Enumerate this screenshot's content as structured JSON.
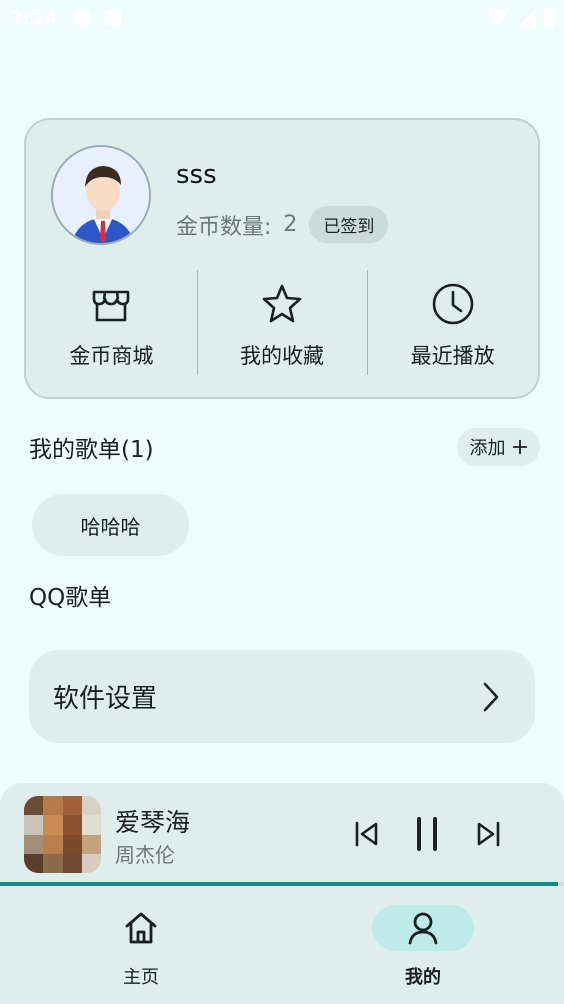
{
  "status_bar": {
    "time": "3:14"
  },
  "profile": {
    "username": "sss",
    "coins_label": "金币数量:",
    "coins_value": "2",
    "checkin_badge": "已签到"
  },
  "actions": [
    {
      "label": "金币商城",
      "icon": "store-icon"
    },
    {
      "label": "我的收藏",
      "icon": "star-icon"
    },
    {
      "label": "最近播放",
      "icon": "clock-icon"
    }
  ],
  "playlists": {
    "title": "我的歌单(1)",
    "add_label": "添加",
    "items": [
      "哈哈哈"
    ],
    "qq_title": "QQ歌单"
  },
  "settings": {
    "label": "软件设置"
  },
  "player": {
    "song": "爱琴海",
    "artist": "周杰伦",
    "progress": 0.99
  },
  "nav": [
    {
      "label": "主页",
      "icon": "home-icon",
      "active": false
    },
    {
      "label": "我的",
      "icon": "person-icon",
      "active": true
    }
  ],
  "colors": {
    "background": "#eefdfb",
    "card": "#dfeeed",
    "accent": "#138a86",
    "nav_active": "#bfeaea"
  }
}
